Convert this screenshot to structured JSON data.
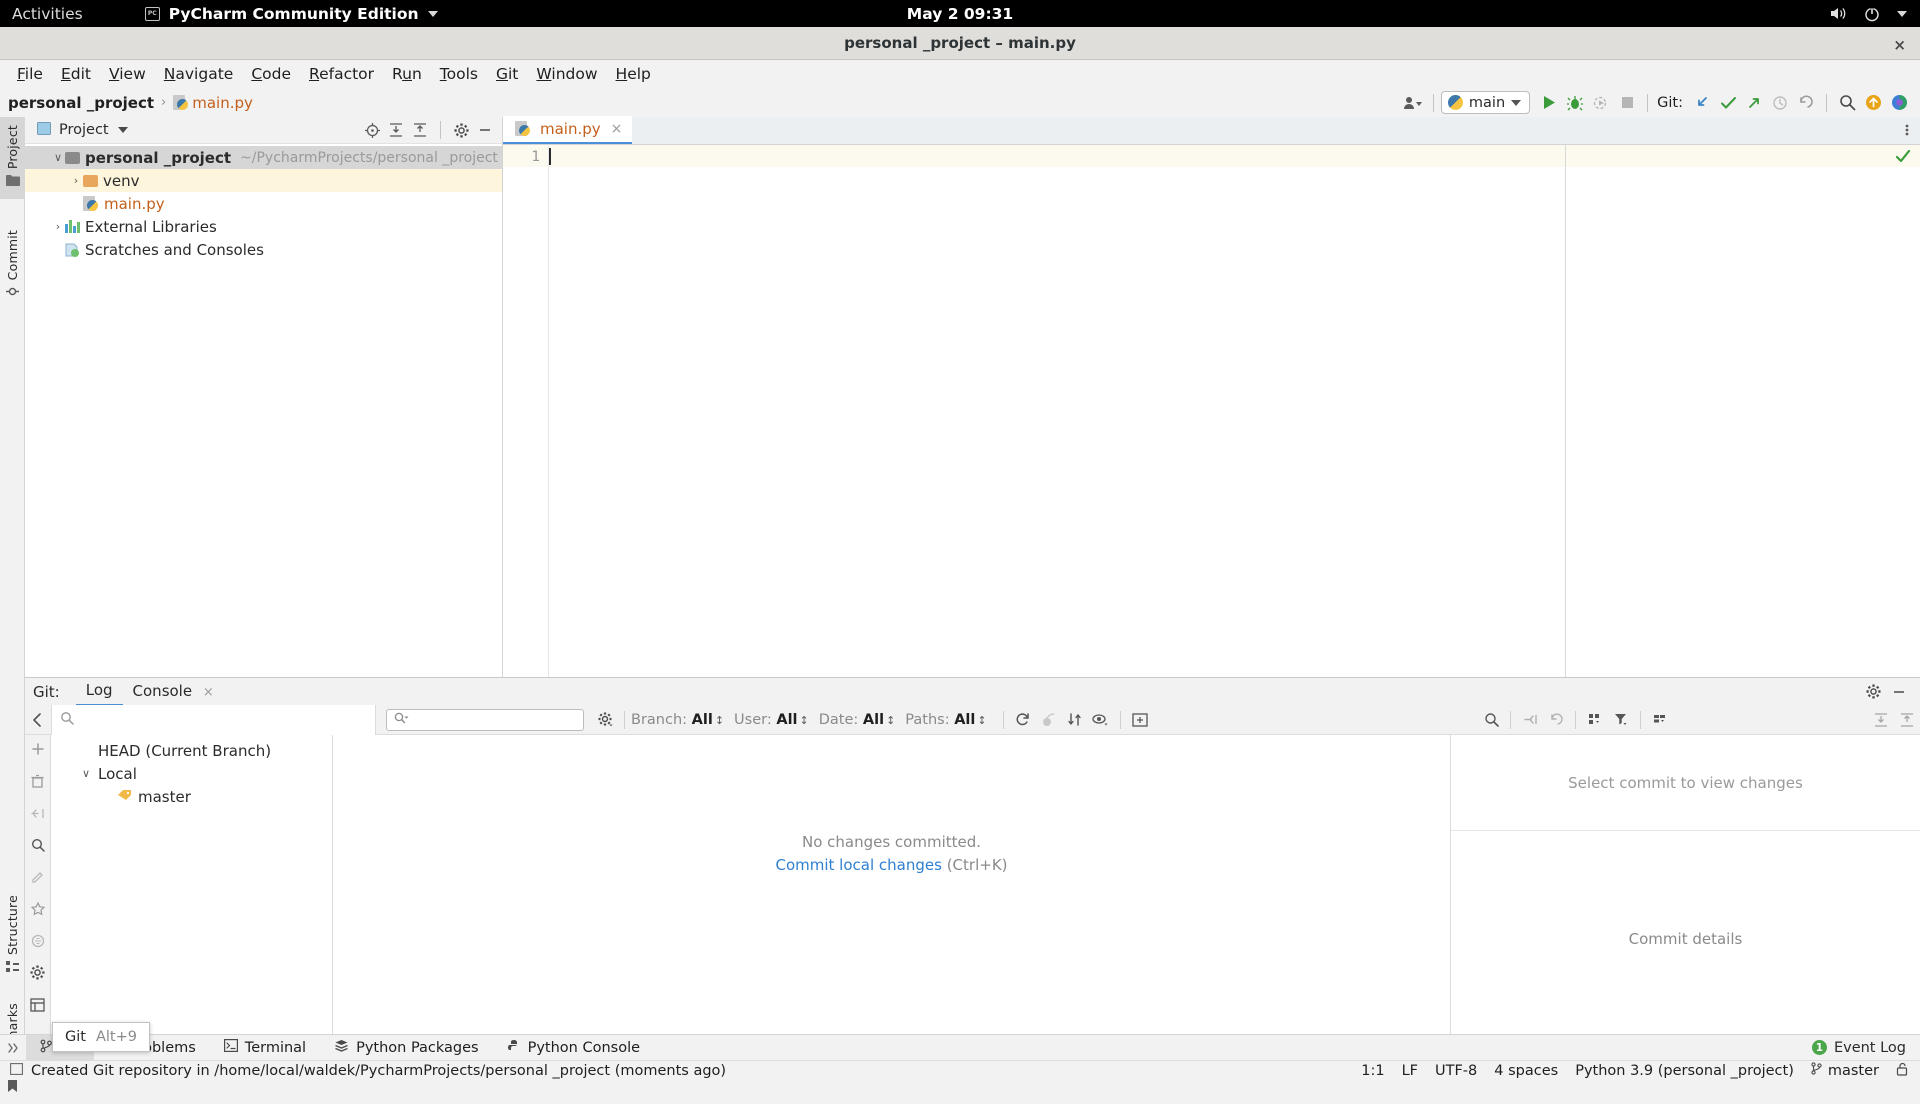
{
  "gnome": {
    "activities": "Activities",
    "app_name": "PyCharm Community Edition",
    "app_icon": "pycharm-icon",
    "clock": "May 2  09:31",
    "icons": [
      "volume-icon",
      "power-icon",
      "chevron-down-icon"
    ]
  },
  "window": {
    "title": "personal _project – main.py",
    "close_label": "×"
  },
  "menu": [
    {
      "label": "File",
      "mnemonic": "F"
    },
    {
      "label": "Edit",
      "mnemonic": "E"
    },
    {
      "label": "View",
      "mnemonic": "V"
    },
    {
      "label": "Navigate",
      "mnemonic": "N"
    },
    {
      "label": "Code",
      "mnemonic": "C"
    },
    {
      "label": "Refactor",
      "mnemonic": "R"
    },
    {
      "label": "Run",
      "mnemonic": "u"
    },
    {
      "label": "Tools",
      "mnemonic": "T"
    },
    {
      "label": "Git",
      "mnemonic": "G"
    },
    {
      "label": "Window",
      "mnemonic": "W"
    },
    {
      "label": "Help",
      "mnemonic": "H"
    }
  ],
  "breadcrumb": {
    "project": "personal _project",
    "separator": "›",
    "file": "main.py"
  },
  "toolbar": {
    "profile_icon": "user-profile-icon",
    "run_config": "main",
    "run_icon": "run-icon",
    "debug_icon": "debug-icon",
    "coverage_icon": "run-with-coverage-icon",
    "stop_icon": "stop-icon",
    "git_label": "Git:",
    "update_icon": "git-update-project-icon",
    "commit_icon": "git-commit-icon",
    "push_icon": "git-push-icon",
    "history_icon": "git-history-icon",
    "rollback_icon": "git-rollback-icon",
    "search_icon": "search-everywhere-icon",
    "updates_icon": "ide-update-icon",
    "ai_icon": "ai-assistant-icon"
  },
  "stripe_left": [
    {
      "label": "Project",
      "icon": "project-icon",
      "selected": true
    },
    {
      "label": "Commit",
      "icon": "commit-icon",
      "selected": false
    },
    {
      "label": "Structure",
      "icon": "structure-icon",
      "selected": false
    },
    {
      "label": "Bookmarks",
      "icon": "bookmarks-icon",
      "selected": false
    }
  ],
  "project_panel": {
    "title": "Project",
    "dropdown_icon": "chevron-down-icon",
    "header_icons": [
      "select-opened-file-icon",
      "expand-all-icon",
      "collapse-all-icon",
      "settings-gear-icon",
      "hide-icon"
    ],
    "tree": [
      {
        "name": "personal _project",
        "path": "~/PycharmProjects/personal _project",
        "icon": "folder-icon",
        "indent": 0,
        "arrow": "∨",
        "bold": true,
        "state": "selected"
      },
      {
        "name": "venv",
        "path": "",
        "icon": "folder-orange-icon",
        "indent": 1,
        "arrow": "›",
        "bold": false,
        "state": "highlight"
      },
      {
        "name": "main.py",
        "path": "",
        "icon": "python-file-icon",
        "indent": 1,
        "arrow": "",
        "bold": false,
        "state": "normal"
      },
      {
        "name": "External Libraries",
        "path": "",
        "icon": "library-icon",
        "indent": 0,
        "arrow": "›",
        "bold": false,
        "state": "normal"
      },
      {
        "name": "Scratches and Consoles",
        "path": "",
        "icon": "scratches-icon",
        "indent": 0,
        "arrow": "",
        "bold": false,
        "state": "normal"
      }
    ]
  },
  "editor": {
    "tab_label": "main.py",
    "tab_icon": "python-file-icon",
    "tab_close": "×",
    "more_icon": "more-vertical-icon",
    "line_numbers": [
      "1"
    ],
    "content": "",
    "inspection_status": "ok-check-icon"
  },
  "git_window": {
    "label": "Git:",
    "tabs": [
      {
        "label": "Log",
        "active": true,
        "closable": false
      },
      {
        "label": "Console",
        "active": false,
        "closable": true
      }
    ],
    "settings_icon": "settings-gear-icon",
    "minimize_icon": "hide-icon",
    "toolbar": {
      "back_icon": "chevron-left-icon",
      "search_icon": "search-icon",
      "search_value": "",
      "filter_icon": "search-dropdown-icon",
      "filter_value": "",
      "gear_icon": "settings-gear-icon",
      "filters": [
        {
          "label": "Branch:",
          "value": "All"
        },
        {
          "label": "User:",
          "value": "All"
        },
        {
          "label": "Date:",
          "value": "All"
        },
        {
          "label": "Paths:",
          "value": "All"
        }
      ],
      "icons": [
        "refresh-icon",
        "cherry-pick-icon",
        "sort-icon",
        "show-details-icon",
        "open-in-editor-icon"
      ],
      "right_icons": [
        "search-icon",
        "collapse-icon",
        "revert-icon",
        "group-by-icon",
        "filter-icon",
        "columns-icon",
        "expand-all-icon",
        "collapse-all-icon"
      ]
    },
    "branch_actions": [
      "add-icon",
      "delete-icon",
      "collapse-icon",
      "search-icon",
      "edit-icon",
      "favorite-icon",
      "filter-icon",
      "settings-gear-icon",
      "tree-icon",
      "more-icon"
    ],
    "branches": [
      {
        "label": "HEAD (Current Branch)",
        "indent": 0,
        "arrow": "",
        "icon": ""
      },
      {
        "label": "Local",
        "indent": 0,
        "arrow": "∨",
        "icon": ""
      },
      {
        "label": "master",
        "indent": 1,
        "arrow": "",
        "icon": "branch-tag-icon"
      }
    ],
    "empty_state": {
      "message": "No changes committed.",
      "link": "Commit local changes",
      "shortcut": "(Ctrl+K)"
    },
    "details": {
      "top": "Select commit to view changes",
      "bottom": "Commit details"
    }
  },
  "tooltip": {
    "label": "Git",
    "shortcut": "Alt+9"
  },
  "bottom_bar": {
    "collapse_icon": "chevron-right-icon",
    "items": [
      {
        "label": "Git",
        "icon": "git-branch-icon",
        "active": true
      },
      {
        "label": "Problems",
        "icon": "problems-icon",
        "active": false
      },
      {
        "label": "Terminal",
        "icon": "terminal-icon",
        "active": false
      },
      {
        "label": "Python Packages",
        "icon": "packages-icon",
        "active": false
      },
      {
        "label": "Python Console",
        "icon": "python-console-icon",
        "active": false
      }
    ],
    "event_log": {
      "label": "Event Log",
      "count": "1"
    }
  },
  "status_bar": {
    "message_icon": "message-icon",
    "message": "Created Git repository in /home/local/waldek/PycharmProjects/personal _project (moments ago)",
    "caret": "1:1",
    "line_sep": "LF",
    "encoding": "UTF-8",
    "indent": "4 spaces",
    "interpreter": "Python 3.9 (personal _project)",
    "branch": "master",
    "branch_icon": "git-branch-icon",
    "lock_icon": "read-only-lock-icon"
  },
  "colors": {
    "accent_blue": "#2f7fd0",
    "tab_underline": "#4a90d9",
    "selection_gray": "#d6d6d6",
    "highlight_cream": "#fdf6dd",
    "orange_file": "#c4601c",
    "green_ok": "#4aa648",
    "panel_bg": "#f2f2f2"
  }
}
